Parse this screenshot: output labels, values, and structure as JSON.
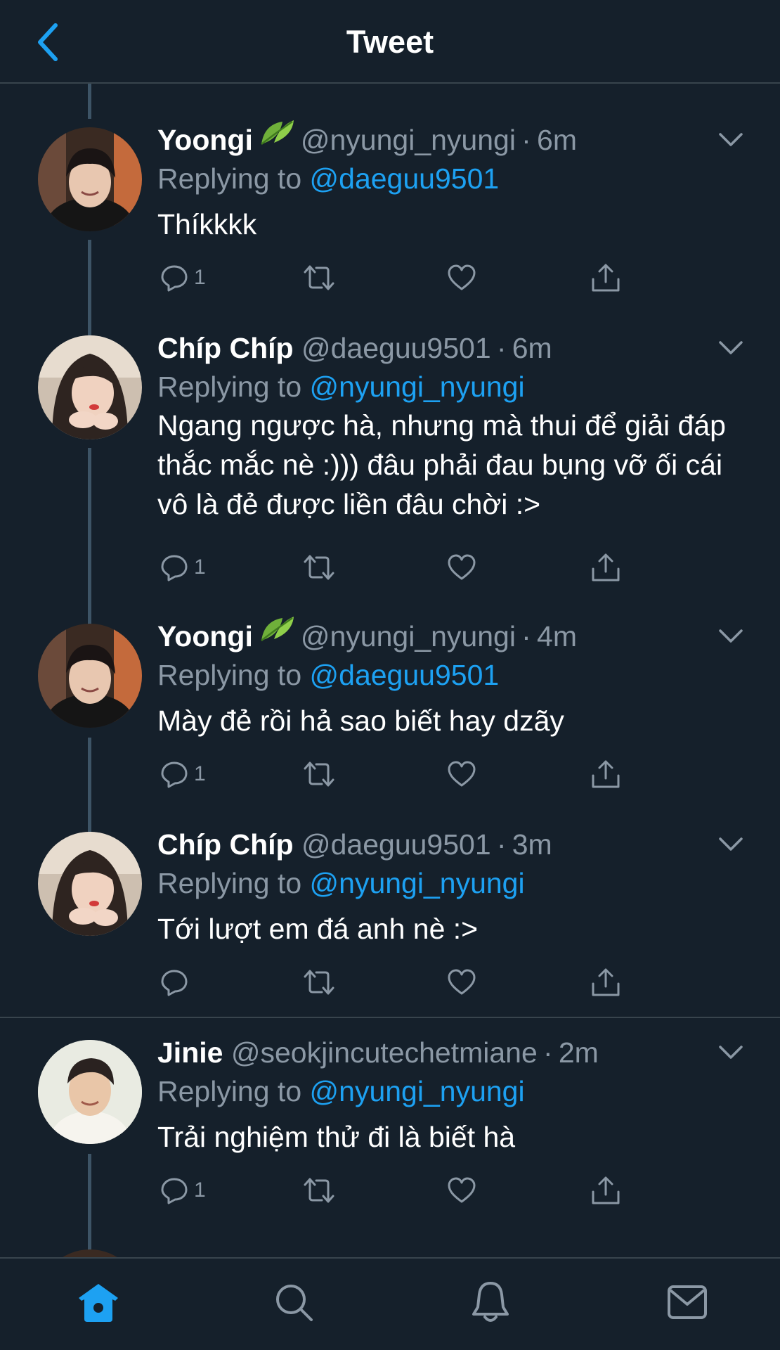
{
  "header": {
    "title": "Tweet",
    "back_icon": "chevron-left-icon"
  },
  "colors": {
    "background": "#15202b",
    "accent": "#1da1f2",
    "muted": "#8b98a5",
    "divider": "#38444d"
  },
  "tweets": [
    {
      "name": "Yoongi",
      "emoji": "🌿",
      "handle": "@nyungi_nyungi",
      "dot": "·",
      "time": "6m",
      "replying_prefix": "Replying to",
      "replying_to": "@daeguu9501",
      "text": "Thíkkkk",
      "reply_count": "1"
    },
    {
      "name": "Chíp Chíp",
      "handle": "@daeguu9501",
      "dot": "·",
      "time": "6m",
      "replying_prefix": "Replying to",
      "replying_to": "@nyungi_nyungi",
      "text": "Ngang ngược hà, nhưng mà thui để giải đáp thắc mắc nè :))) đâu phải đau bụng vỡ ối cái vô là đẻ được liền đâu chời :>",
      "reply_count": "1"
    },
    {
      "name": "Yoongi",
      "emoji": "🌿",
      "handle": "@nyungi_nyungi",
      "dot": "·",
      "time": "4m",
      "replying_prefix": "Replying to",
      "replying_to": "@daeguu9501",
      "text": "Mày đẻ rồi hả sao biết hay dzãy",
      "reply_count": "1"
    },
    {
      "name": "Chíp Chíp",
      "handle": "@daeguu9501",
      "dot": "·",
      "time": "3m",
      "replying_prefix": "Replying to",
      "replying_to": "@nyungi_nyungi",
      "text": "Tới lượt em đá anh nè :>",
      "reply_count": ""
    },
    {
      "name": "Jinie",
      "handle": "@seokjincutechetmiane",
      "dot": "·",
      "time": "2m",
      "replying_prefix": "Replying to",
      "replying_to": "@nyungi_nyungi",
      "text": "Trải nghiệm thử đi là biết hà",
      "reply_count": "1"
    }
  ],
  "tab_bar": {
    "items": [
      "home-icon",
      "search-icon",
      "notifications-icon",
      "messages-icon"
    ],
    "active": "home-icon"
  }
}
